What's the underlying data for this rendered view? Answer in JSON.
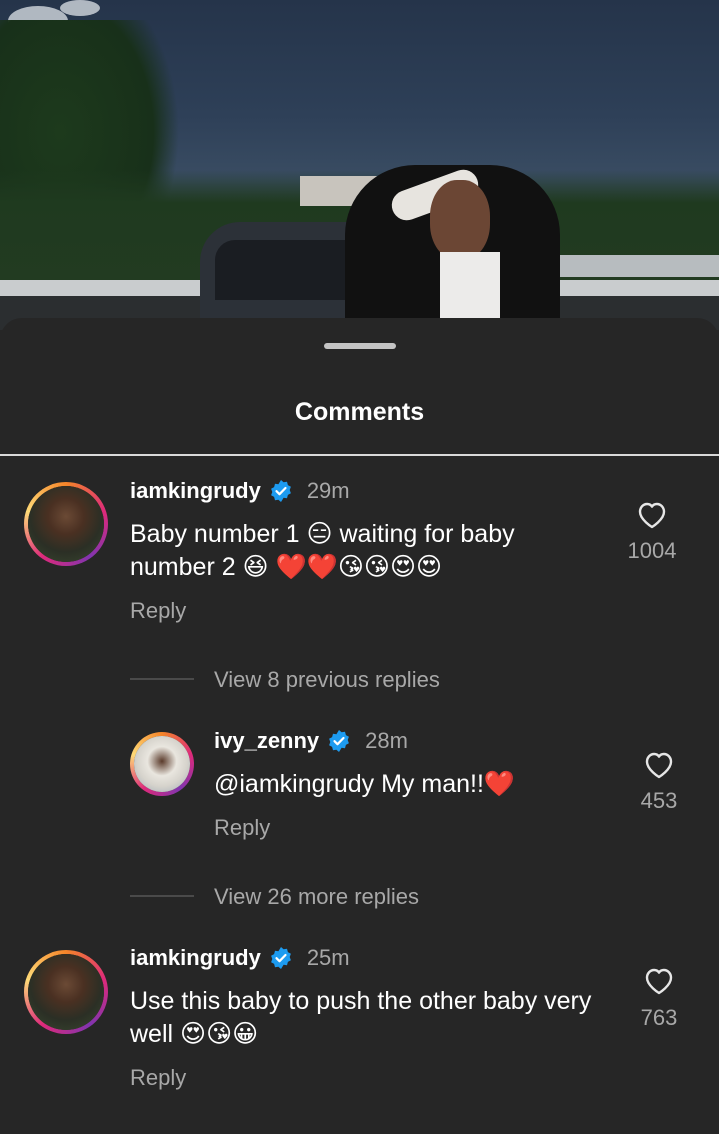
{
  "sheet": {
    "title": "Comments"
  },
  "comments": [
    {
      "username": "iamkingrudy",
      "time": "29m",
      "text": "Baby number 1 😑 waiting for baby number 2 😆 ❤️❤️😘😘😍😍",
      "reply_label": "Reply",
      "likes": "1004"
    },
    {
      "username": "ivy_zenny",
      "time": "28m",
      "text": "@iamkingrudy My man!!❤️",
      "reply_label": "Reply",
      "likes": "453"
    },
    {
      "username": "iamkingrudy",
      "time": "25m",
      "text": "Use this baby to push the other baby very well 😍😘😀",
      "reply_label": "Reply",
      "likes": "763"
    }
  ],
  "threads": {
    "view_previous": "View 8 previous replies",
    "view_more": "View 26 more replies"
  },
  "colors": {
    "background": "#262626",
    "verified": "#1d9bf0",
    "muted_text": "#a8a8a8"
  },
  "icons": [
    "verified-icon",
    "heart-icon"
  ]
}
